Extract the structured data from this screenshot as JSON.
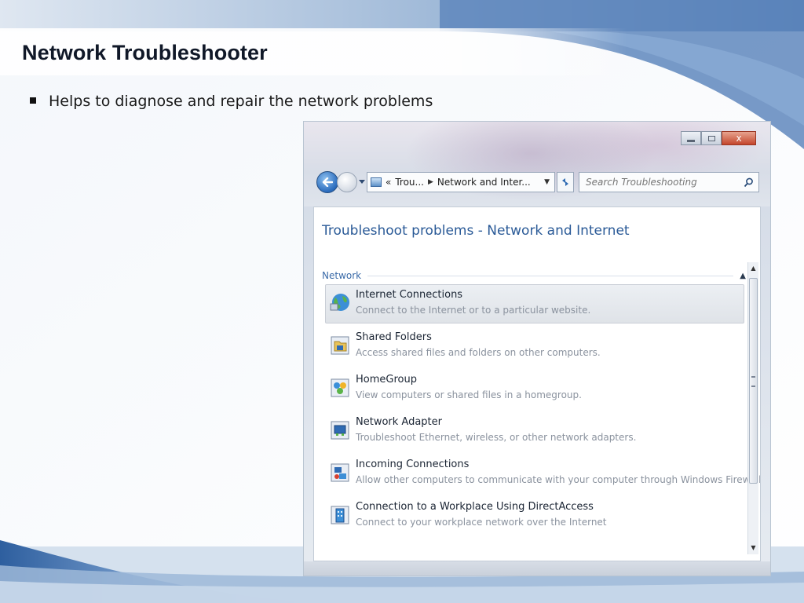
{
  "slide": {
    "title": "Network Troubleshooter",
    "bullet": "Helps to diagnose and repair the network problems",
    "colors": {
      "title_text": "#101828",
      "wave_blue": "#3f72b0",
      "wave_light": "#a8c2df"
    }
  },
  "window": {
    "caption_buttons": [
      "minimize-icon",
      "maximize-icon",
      "close-icon"
    ],
    "close_glyph": "x",
    "address": {
      "chevron": "«",
      "segments": [
        "Trou...",
        "Network and Inter..."
      ],
      "separator": "▶"
    },
    "search": {
      "placeholder": "Search Troubleshooting"
    },
    "content_title": "Troubleshoot problems - Network and Internet",
    "section": {
      "label": "Network",
      "collapse_glyph": "▲"
    },
    "items": [
      {
        "title": "Internet Connections",
        "description": "Connect to the Internet or to a particular website.",
        "icon": "internet-globe-icon",
        "hovered": true
      },
      {
        "title": "Shared Folders",
        "description": "Access shared files and folders on other computers.",
        "icon": "shared-folder-icon",
        "hovered": false
      },
      {
        "title": "HomeGroup",
        "description": "View computers or shared files in a homegroup.",
        "icon": "homegroup-icon",
        "hovered": false
      },
      {
        "title": "Network Adapter",
        "description": "Troubleshoot Ethernet, wireless, or other network adapters.",
        "icon": "network-adapter-icon",
        "hovered": false
      },
      {
        "title": "Incoming Connections",
        "description": "Allow other computers to communicate with your computer through Windows Firewall.",
        "icon": "incoming-connections-icon",
        "hovered": false
      },
      {
        "title": "Connection to a Workplace Using DirectAccess",
        "description": "Connect to your workplace network over the Internet",
        "icon": "directaccess-building-icon",
        "hovered": false
      }
    ]
  }
}
